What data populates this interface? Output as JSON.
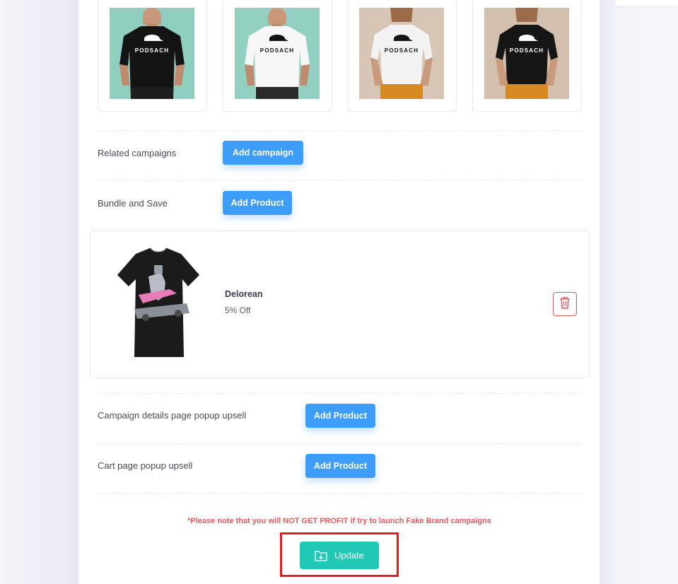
{
  "mockups": [
    {
      "brand_text": "PODSACH",
      "shirt_color": "#141414",
      "bg_color": "#8fcfbf",
      "variant": "male-black-tee"
    },
    {
      "brand_text": "PODSACH",
      "shirt_color": "#f7f7f7",
      "bg_color": "#92d1c1",
      "variant": "male-white-tee"
    },
    {
      "brand_text": "PODSACH",
      "shirt_color": "#f2f2f2",
      "bg_color": "#d7c6b5",
      "variant": "female-white-tee"
    },
    {
      "brand_text": "PODSACH",
      "shirt_color": "#161616",
      "bg_color": "#d2bfad",
      "variant": "female-black-tee"
    }
  ],
  "related_campaigns": {
    "label": "Related campaigns",
    "button": "Add campaign"
  },
  "bundle_and_save": {
    "label": "Bundle and Save",
    "button": "Add Product",
    "product": {
      "name": "Delorean",
      "discount": "5% Off",
      "delete_icon": "trash-icon"
    }
  },
  "campaign_popup_upsell": {
    "label": "Campaign details page popup upsell",
    "button": "Add Product"
  },
  "cart_popup_upsell": {
    "label": "Cart page popup upsell",
    "button": "Add Product"
  },
  "note": "*Please note that you will NOT GET PROFIT if try to launch Fake Brand campaigns",
  "update": {
    "label": "Update",
    "icon": "folder-download-icon"
  },
  "colors": {
    "primary_button": "#3e9df8",
    "update_button": "#22c8b6",
    "warning_text": "#e85a5a",
    "highlight_border": "#dc1f1f"
  }
}
